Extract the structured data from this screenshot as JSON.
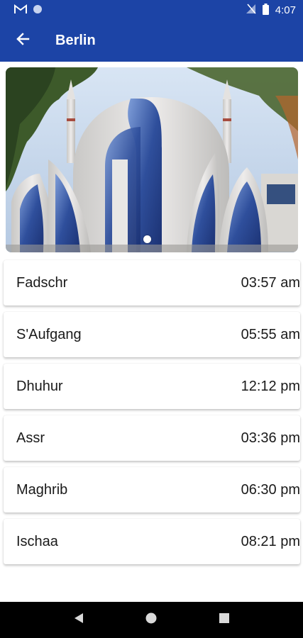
{
  "status_bar": {
    "time": "4:07",
    "icons": [
      "gmail-icon",
      "circle-icon",
      "no-signal-icon",
      "battery-icon"
    ]
  },
  "app_bar": {
    "title": "Berlin",
    "back_icon": "arrow-back-icon",
    "color": "#1c44a6"
  },
  "hero": {
    "image": "mosque-photo",
    "carousel": {
      "count": 1,
      "active": 1
    }
  },
  "prayers": [
    {
      "name": "Fadschr",
      "time": "03:57 am"
    },
    {
      "name": "S'Aufgang",
      "time": "05:55 am"
    },
    {
      "name": "Dhuhur",
      "time": "12:12 pm"
    },
    {
      "name": "Assr",
      "time": "03:36 pm"
    },
    {
      "name": "Maghrib",
      "time": "06:30 pm"
    },
    {
      "name": "Ischaa",
      "time": "08:21 pm"
    }
  ],
  "nav_bar": {
    "buttons": [
      "back-triangle-icon",
      "home-circle-icon",
      "recents-square-icon"
    ]
  }
}
